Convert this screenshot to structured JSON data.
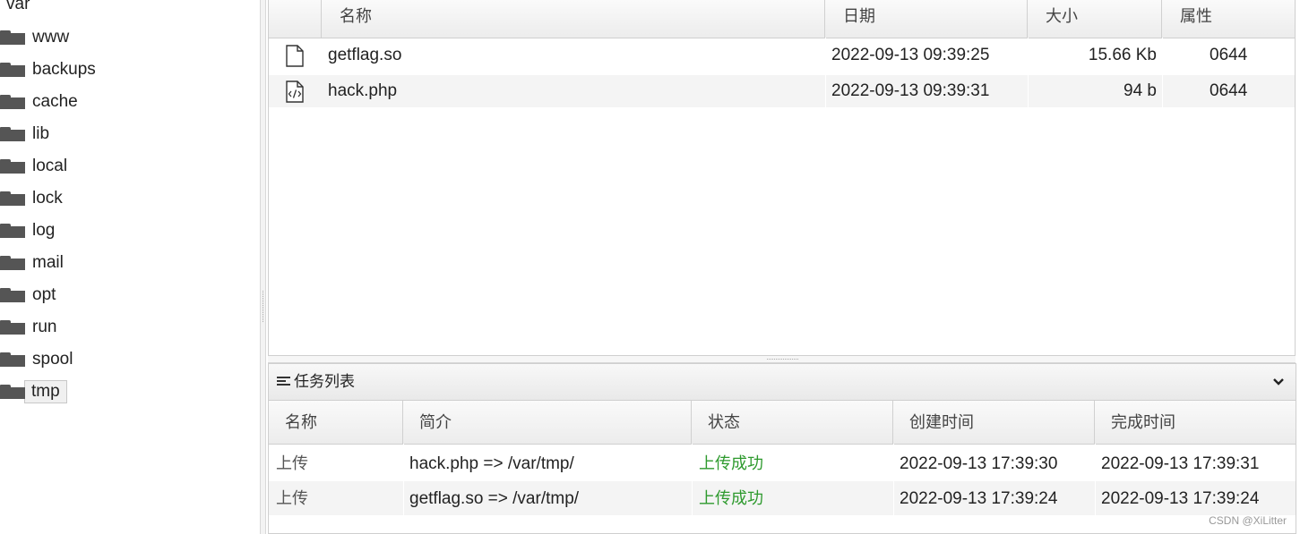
{
  "tree": {
    "root": "var",
    "items": [
      "www",
      "backups",
      "cache",
      "lib",
      "local",
      "lock",
      "log",
      "mail",
      "opt",
      "run",
      "spool",
      "tmp"
    ],
    "selected": "tmp"
  },
  "files": {
    "columns": {
      "name": "名称",
      "date": "日期",
      "size": "大小",
      "perm": "属性"
    },
    "rows": [
      {
        "icon": "file-icon",
        "name": "getflag.so",
        "date": "2022-09-13 09:39:25",
        "size": "15.66 Kb",
        "perm": "0644"
      },
      {
        "icon": "php-file-icon",
        "name": "hack.php",
        "date": "2022-09-13 09:39:31",
        "size": "94 b",
        "perm": "0644"
      }
    ]
  },
  "tasks": {
    "title": "任务列表",
    "title_icon": "list-icon",
    "toggle_icon": "chevron-down-icon",
    "columns": {
      "name": "名称",
      "desc": "简介",
      "status": "状态",
      "created": "创建时间",
      "finished": "完成时间"
    },
    "rows": [
      {
        "name": "上传",
        "desc": "hack.php => /var/tmp/",
        "status": "上传成功",
        "created": "2022-09-13 17:39:30",
        "finished": "2022-09-13 17:39:31"
      },
      {
        "name": "上传",
        "desc": "getflag.so => /var/tmp/",
        "status": "上传成功",
        "created": "2022-09-13 17:39:24",
        "finished": "2022-09-13 17:39:24"
      }
    ],
    "status_color": "#2e9a2e"
  },
  "watermark": "CSDN @XiLitter"
}
